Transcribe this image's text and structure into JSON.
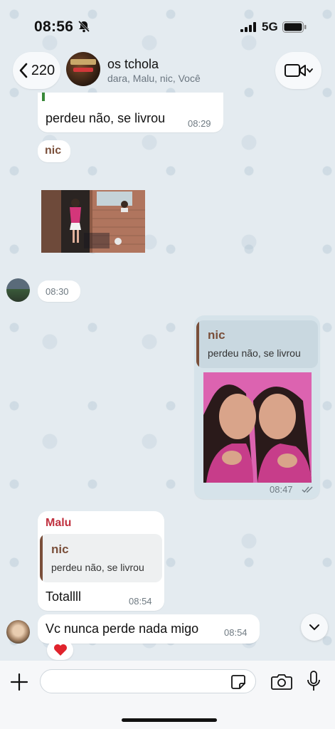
{
  "status_bar": {
    "time": "08:56",
    "network": "5G",
    "icons": [
      "bell-slash-icon",
      "signal-icon",
      "battery-icon"
    ]
  },
  "header": {
    "back_count": "220",
    "title": "os tchola",
    "members": "dara, Malu, nic, Você",
    "icons": [
      "chevron-left-icon",
      "video-camera-icon",
      "chevron-down-icon"
    ]
  },
  "messages": [
    {
      "type": "text",
      "direction": "in",
      "text": "perdeu não, se livrou",
      "time": "08:29"
    },
    {
      "type": "sender-label",
      "direction": "in",
      "sender": "nic"
    },
    {
      "type": "image",
      "direction": "in",
      "description": "video still"
    },
    {
      "type": "time-only",
      "direction": "in",
      "time": "08:30"
    },
    {
      "type": "reply-image",
      "direction": "out",
      "quote_author": "nic",
      "quote_text": "perdeu não, se livrou",
      "time": "08:47",
      "status": "read"
    },
    {
      "type": "reply-text",
      "direction": "in",
      "sender": "Malu",
      "quote_author": "nic",
      "quote_text": "perdeu não, se livrou",
      "text": "Totallll",
      "time": "08:54"
    },
    {
      "type": "text",
      "direction": "in",
      "text": "Vc nunca perde nada migo",
      "time": "08:54",
      "reaction": "❤️"
    }
  ],
  "colors": {
    "malu": "#c0313f",
    "nic": "#7a4f3a",
    "outgoing_bubble": "#d6e3ea",
    "incoming_bubble": "#ffffff"
  },
  "input": {
    "placeholder": "",
    "icons": [
      "plus-icon",
      "sticker-icon",
      "camera-icon",
      "microphone-icon"
    ]
  }
}
